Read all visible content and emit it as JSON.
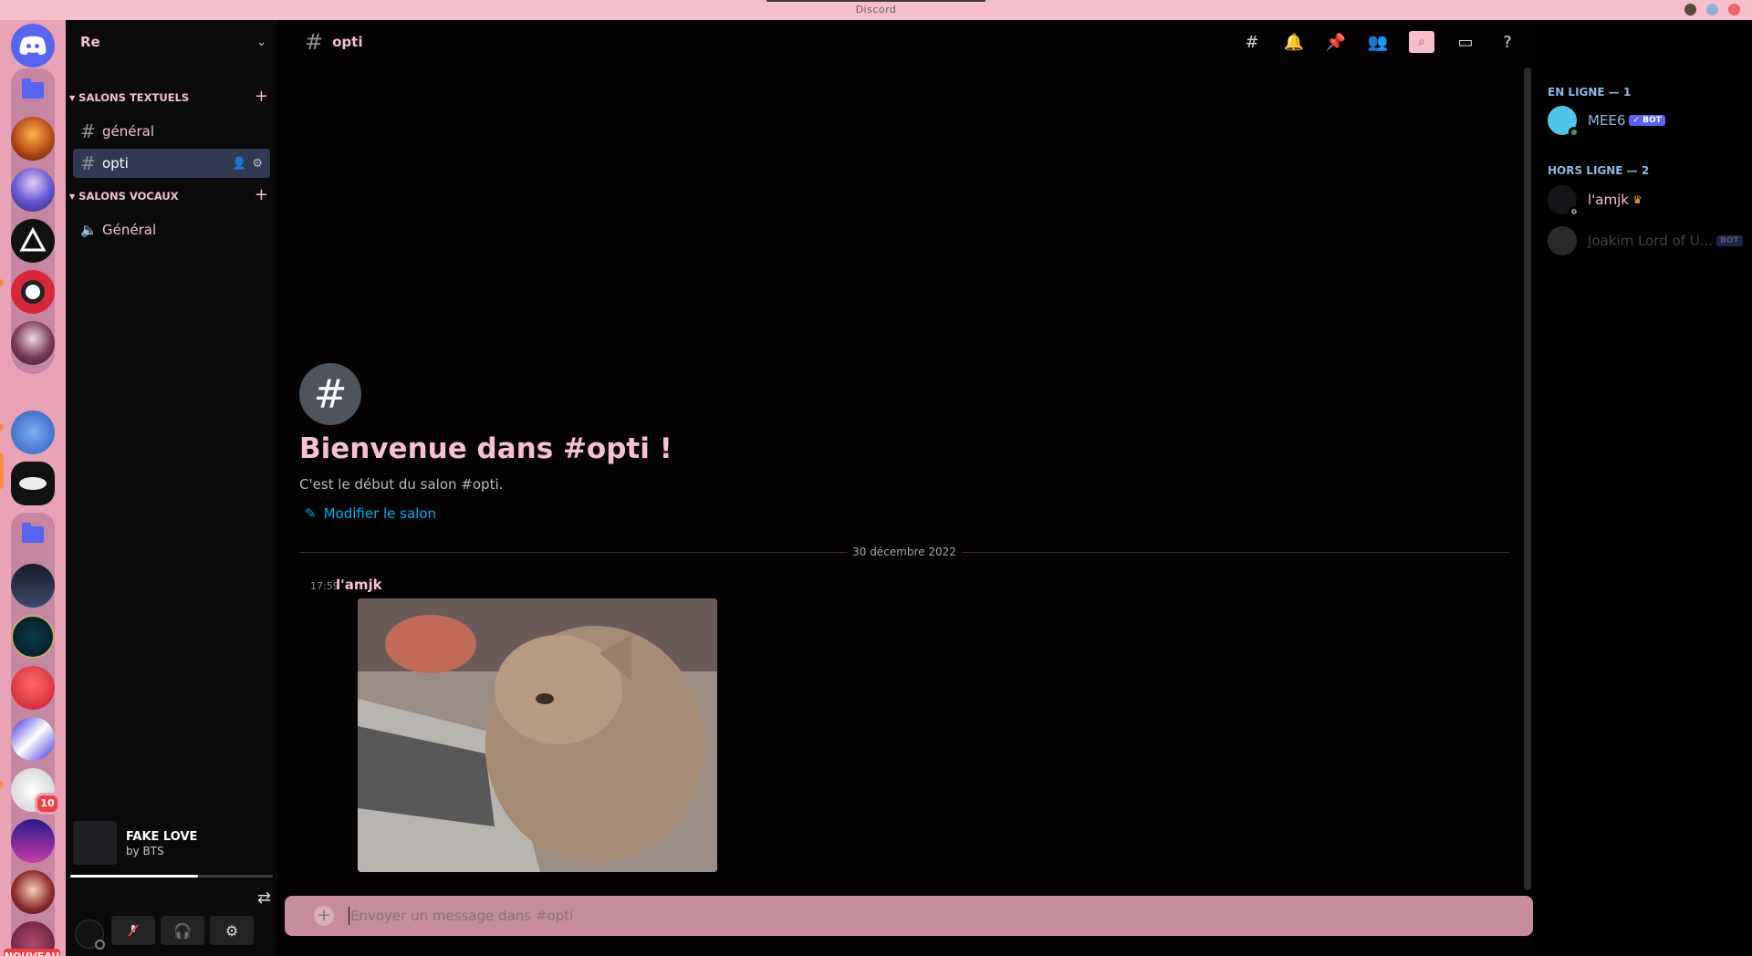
{
  "window": {
    "title": "Discord"
  },
  "colors": {
    "accent": "#f7c1d0",
    "link": "#00aff4",
    "blurple": "#5865f2",
    "online": "#3ba55d",
    "badge": "#ed4245"
  },
  "rail": {
    "badge_count": "10",
    "new_label": "NOUVEAU"
  },
  "guild": {
    "name": "Re"
  },
  "categories": {
    "text": "SALONS TEXTUELS",
    "voice": "SALONS VOCAUX"
  },
  "channels": {
    "text": [
      "général",
      "opti"
    ],
    "voice": [
      "Général"
    ]
  },
  "music": {
    "song": "FAKE LOVE",
    "artist": "by BTS",
    "progress": 0.63
  },
  "header": {
    "channel_name": "opti"
  },
  "intro": {
    "welcome": "Bienvenue dans #opti !",
    "subtitle": "C'est le début du salon #opti.",
    "edit_label": "Modifier le salon"
  },
  "messages": {
    "date_divider": "30 décembre 2022",
    "items": [
      {
        "time": "17:59",
        "author": "l'amjk",
        "attachment": "cat gif"
      }
    ]
  },
  "composer": {
    "placeholder": "Envoyer un message dans #opti"
  },
  "members": {
    "online_header": "EN LIGNE — 1",
    "offline_header": "HORS LIGNE — 2",
    "online": [
      {
        "name": "MEE6",
        "badge": "✓ BOT"
      }
    ],
    "offline": [
      {
        "name": "l'amjk",
        "icon": "crown-icon"
      },
      {
        "name": "Joakim Lord of U...",
        "badge": "BOT"
      }
    ]
  }
}
